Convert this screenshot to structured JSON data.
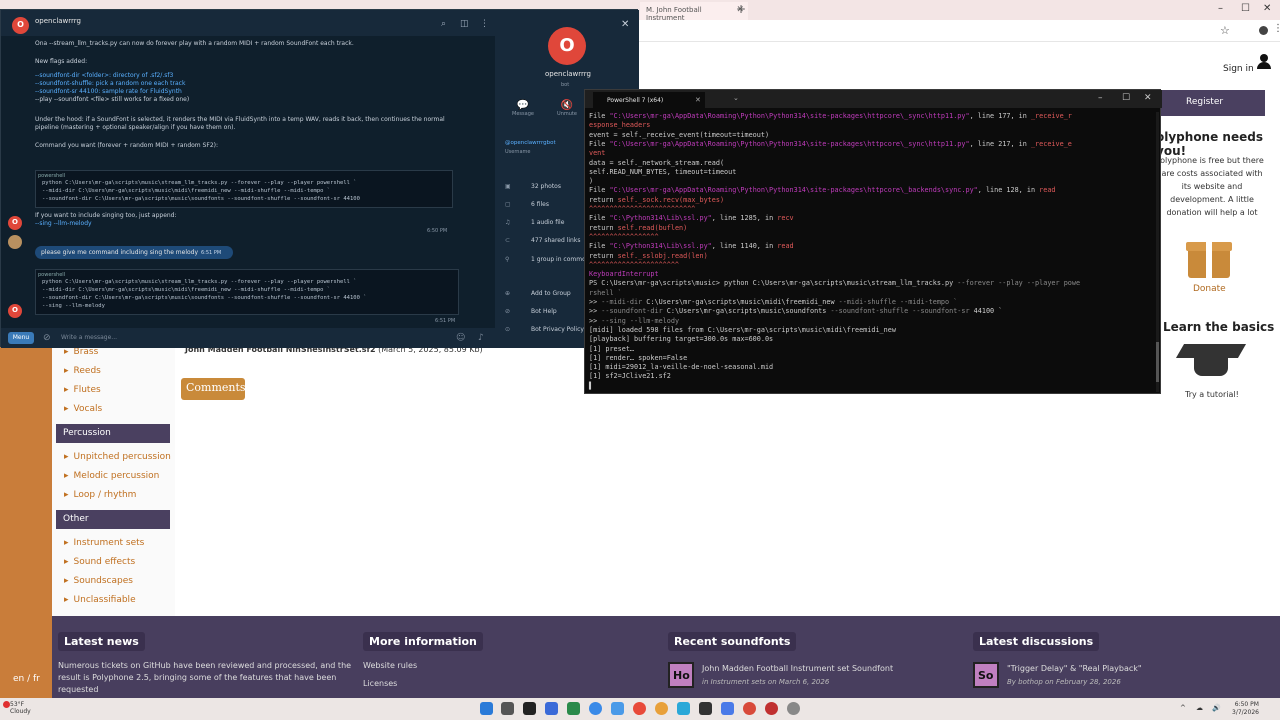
{
  "browser": {
    "tab_title": "M. John Football Instrument",
    "tab_close": "✕",
    "new_tab": "+",
    "win_min": "–",
    "win_max": "☐",
    "win_close": "✕",
    "bookmark_icon": "star-icon",
    "profile_icon": "profile-icon"
  },
  "site": {
    "sign_in": "Sign in",
    "register": "Register",
    "needs_you_title": "olyphone needs you!",
    "needs_you_text": "olyphone is free but there are costs associated with its website and development. A little donation will help a lot",
    "donate": "Donate",
    "learn_title": "Learn the basics",
    "tutorial": "Try a tutorial!",
    "lang": "en / fr",
    "sidebar": [
      {
        "kind": "item",
        "label": "Brass"
      },
      {
        "kind": "item",
        "label": "Reeds"
      },
      {
        "kind": "item",
        "label": "Flutes"
      },
      {
        "kind": "item",
        "label": "Vocals"
      },
      {
        "kind": "cat",
        "label": "Percussion"
      },
      {
        "kind": "item",
        "label": "Unpitched percussion"
      },
      {
        "kind": "item",
        "label": "Melodic percussion"
      },
      {
        "kind": "item",
        "label": "Loop / rhythm"
      },
      {
        "kind": "cat",
        "label": "Other"
      },
      {
        "kind": "item",
        "label": "Instrument sets"
      },
      {
        "kind": "item",
        "label": "Sound effects"
      },
      {
        "kind": "item",
        "label": "Soundscapes"
      },
      {
        "kind": "item",
        "label": "Unclassifiable"
      }
    ],
    "file_name": "John Madden Football NinSnesInstrSet.sf2",
    "file_meta": "(March 5, 2025, 85.09 Kb)",
    "comments": "Comments",
    "footer": {
      "news_title": "Latest news",
      "news_text": "Numerous tickets on GitHub have been reviewed and processed, and the result is Polyphone 2.5, bringing some of the features that have been requested",
      "more_title": "More information",
      "more_links": [
        "Website rules",
        "Licenses"
      ],
      "recent_title": "Recent soundfonts",
      "recent_avatar": "Ho",
      "recent_name": "John Madden Football Instrument set Soundfont",
      "recent_meta": "in Instrument sets on March 6, 2026",
      "disc_title": "Latest discussions",
      "disc_avatar": "So",
      "disc_name": "\"Trigger Delay\" & \"Real Playback\"",
      "disc_meta": "By bothop on February 28, 2026"
    }
  },
  "chat": {
    "header_name": "openclawrrrg",
    "header_status": "bot",
    "avatar_letter": "O",
    "lines": [
      {
        "text": "Ona --stream_llm_tracks.py can now do forever play with a random MIDI + random SoundFont each track.",
        "blue": false
      },
      {
        "text": "New flags added:",
        "blue": false
      },
      {
        "text": "--soundfont-dir <folder>: directory of .sf2/.sf3",
        "blue": true
      },
      {
        "text": "--soundfont-shuffle: pick a random one each track",
        "blue": true
      },
      {
        "text": "--soundfont-sr 44100: sample rate for FluidSynth",
        "blue": true
      },
      {
        "text": "--play --soundfont <file> still works for a fixed one)",
        "blue": false
      },
      {
        "text": "Under the hood: if a SoundFont is selected, it renders the MIDI via FluidSynth into a temp WAV, reads it back, then continues the normal",
        "blue": false
      },
      {
        "text": "pipeline (mastering + optional speaker/align if you have them on).",
        "blue": false
      },
      {
        "text": "Command you want (forever + random MIDI + random SF2):",
        "blue": false
      }
    ],
    "code1_label": "powershell",
    "code1": [
      "python C:\\Users\\mr-ga\\scripts\\music\\stream_llm_tracks.py --forever --play --player powershell `",
      "  --midi-dir C:\\Users\\mr-ga\\scripts\\music\\midi\\freemidi_new --midi-shuffle --midi-tempo `",
      "  --soundfont-dir C:\\Users\\mr-ga\\scripts\\music\\soundfonts --soundfont-shuffle --soundfont-sr 44100"
    ],
    "after_code1": "If you want to include singing too, just append:",
    "after_code1_b": "--sing --llm-melody",
    "time1": "6:50 PM",
    "user_msg": "please give me command including sing the melody",
    "time2": "6:51 PM",
    "code2_label": "powershell",
    "code2": [
      "python C:\\Users\\mr-ga\\scripts\\music\\stream_llm_tracks.py --forever --play --player powershell `",
      "  --midi-dir C:\\Users\\mr-ga\\scripts\\music\\midi\\freemidi_new --midi-shuffle --midi-tempo `",
      "  --soundfont-dir C:\\Users\\mr-ga\\scripts\\music\\soundfonts --soundfont-shuffle --soundfont-sr 44100 `",
      "  --sing --llm-melody"
    ],
    "time3": "6:51 PM",
    "menu": "Menu",
    "input_placeholder": "Write a message...",
    "profile": {
      "name": "openclawrrrg",
      "status": "bot",
      "actions": [
        {
          "icon": "💬",
          "label": "Message"
        },
        {
          "icon": "🔇",
          "label": "Unmute"
        }
      ],
      "username": "@openclawrrrgbot",
      "username_label": "Username",
      "rows": [
        {
          "icon": "▣",
          "label": "32 photos"
        },
        {
          "icon": "▢",
          "label": "6 files"
        },
        {
          "icon": "♫",
          "label": "1 audio file"
        },
        {
          "icon": "⊂",
          "label": "477 shared links"
        },
        {
          "icon": "⚲",
          "label": "1 group in common"
        },
        {
          "icon": "⊕",
          "label": "Add to Group"
        },
        {
          "icon": "⊘",
          "label": "Bot Help"
        },
        {
          "icon": "⊙",
          "label": "Bot Privacy Policy"
        }
      ]
    },
    "close": "✕"
  },
  "ps": {
    "tab_title": "PowerShell 7 (x64)",
    "tab_close": "✕",
    "tab_dropdown": "⌄",
    "win_min": "–",
    "win_max": "☐",
    "win_close": "✕",
    "lines": [
      [
        {
          "c": "",
          "t": "  File "
        },
        {
          "c": "pk",
          "t": "\"C:\\Users\\mr-ga\\AppData\\Roaming\\Python\\Python314\\site-packages\\httpcore\\_sync\\http11.py\""
        },
        {
          "c": "",
          "t": ", line 177, in "
        },
        {
          "c": "rd",
          "t": "_receive_r"
        }
      ],
      [
        {
          "c": "rd",
          "t": "esponse_headers"
        }
      ],
      [
        {
          "c": "",
          "t": "    event = self._receive_event(timeout=timeout)"
        }
      ],
      [
        {
          "c": "",
          "t": "  File "
        },
        {
          "c": "pk",
          "t": "\"C:\\Users\\mr-ga\\AppData\\Roaming\\Python\\Python314\\site-packages\\httpcore\\_sync\\http11.py\""
        },
        {
          "c": "",
          "t": ", line 217, in "
        },
        {
          "c": "rd",
          "t": "_receive_e"
        }
      ],
      [
        {
          "c": "rd",
          "t": "vent"
        }
      ],
      [
        {
          "c": "",
          "t": "    data = self._network_stream.read("
        }
      ],
      [
        {
          "c": "",
          "t": "        self.READ_NUM_BYTES, timeout=timeout"
        }
      ],
      [
        {
          "c": "",
          "t": "    )"
        }
      ],
      [
        {
          "c": "",
          "t": "  File "
        },
        {
          "c": "pk",
          "t": "\"C:\\Users\\mr-ga\\AppData\\Roaming\\Python\\Python314\\site-packages\\httpcore\\_backends\\sync.py\""
        },
        {
          "c": "",
          "t": ", line 128, in "
        },
        {
          "c": "rd",
          "t": "read"
        }
      ],
      [
        {
          "c": "",
          "t": "    return "
        },
        {
          "c": "rd",
          "t": "self._sock.recv(max_bytes)"
        }
      ],
      [
        {
          "c": "rd",
          "t": "           ^^^^^^^^^^^^^^^^^^^^^^^^^^"
        }
      ],
      [
        {
          "c": "",
          "t": "  File "
        },
        {
          "c": "pk",
          "t": "\"C:\\Python314\\Lib\\ssl.py\""
        },
        {
          "c": "",
          "t": ", line 1285, in "
        },
        {
          "c": "rd",
          "t": "recv"
        }
      ],
      [
        {
          "c": "",
          "t": "    return "
        },
        {
          "c": "rd",
          "t": "self.read(buflen)"
        }
      ],
      [
        {
          "c": "rd",
          "t": "           ^^^^^^^^^^^^^^^^^"
        }
      ],
      [
        {
          "c": "",
          "t": "  File "
        },
        {
          "c": "pk",
          "t": "\"C:\\Python314\\Lib\\ssl.py\""
        },
        {
          "c": "",
          "t": ", line 1140, in "
        },
        {
          "c": "rd",
          "t": "read"
        }
      ],
      [
        {
          "c": "",
          "t": "    return "
        },
        {
          "c": "rd",
          "t": "self._sslobj.read(len)"
        }
      ],
      [
        {
          "c": "rd",
          "t": "           ^^^^^^^^^^^^^^^^^^^^^^"
        }
      ],
      [
        {
          "c": "pk",
          "t": "KeyboardInterrupt"
        }
      ],
      [
        {
          "c": "",
          "t": "PS C:\\Users\\mr-ga\\scripts\\music> python C:\\Users\\mr-ga\\scripts\\music\\stream_llm_tracks.py "
        },
        {
          "c": "gy",
          "t": "--forever --play --player powe"
        }
      ],
      [
        {
          "c": "gy",
          "t": "rshell `"
        }
      ],
      [
        {
          "c": "",
          "t": ">>   "
        },
        {
          "c": "gy",
          "t": "--midi-dir"
        },
        {
          "c": "",
          "t": " C:\\Users\\mr-ga\\scripts\\music\\midi\\freemidi_new "
        },
        {
          "c": "gy",
          "t": "--midi-shuffle --midi-tempo `"
        }
      ],
      [
        {
          "c": "",
          "t": ">>   "
        },
        {
          "c": "gy",
          "t": "--soundfont-dir"
        },
        {
          "c": "",
          "t": " C:\\Users\\mr-ga\\scripts\\music\\soundfonts "
        },
        {
          "c": "gy",
          "t": "--soundfont-shuffle --soundfont-sr"
        },
        {
          "c": "",
          "t": " 44100 `"
        }
      ],
      [
        {
          "c": "",
          "t": ">>   "
        },
        {
          "c": "gy",
          "t": "--sing --llm-melody"
        }
      ],
      [
        {
          "c": "",
          "t": "[midi] loaded 598 files from C:\\Users\\mr-ga\\scripts\\music\\midi\\freemidi_new"
        }
      ],
      [
        {
          "c": "",
          "t": "[playback] buffering target=300.0s max=600.0s"
        }
      ],
      [
        {
          "c": "",
          "t": "[1] preset…"
        }
      ],
      [
        {
          "c": "",
          "t": "[1] render… spoken=False"
        }
      ],
      [
        {
          "c": "",
          "t": "[1] midi=29012_la-veille-de-noel-seasonal.mid"
        }
      ],
      [
        {
          "c": "",
          "t": "[1] sf2=JClive21.sf2"
        }
      ],
      [
        {
          "c": "",
          "t": "▌"
        }
      ]
    ]
  },
  "taskbar": {
    "weather_temp": "53°F",
    "weather_desc": "Cloudy",
    "time": "6:50 PM",
    "date": "3/7/2026",
    "tray": [
      "^",
      "☁",
      "🔊"
    ]
  },
  "colors": {
    "site_accent": "#c97d3a",
    "site_dark": "#4a4060",
    "chat_bg": "#0f1f2c",
    "terminal_bg": "#0c0c0c"
  }
}
